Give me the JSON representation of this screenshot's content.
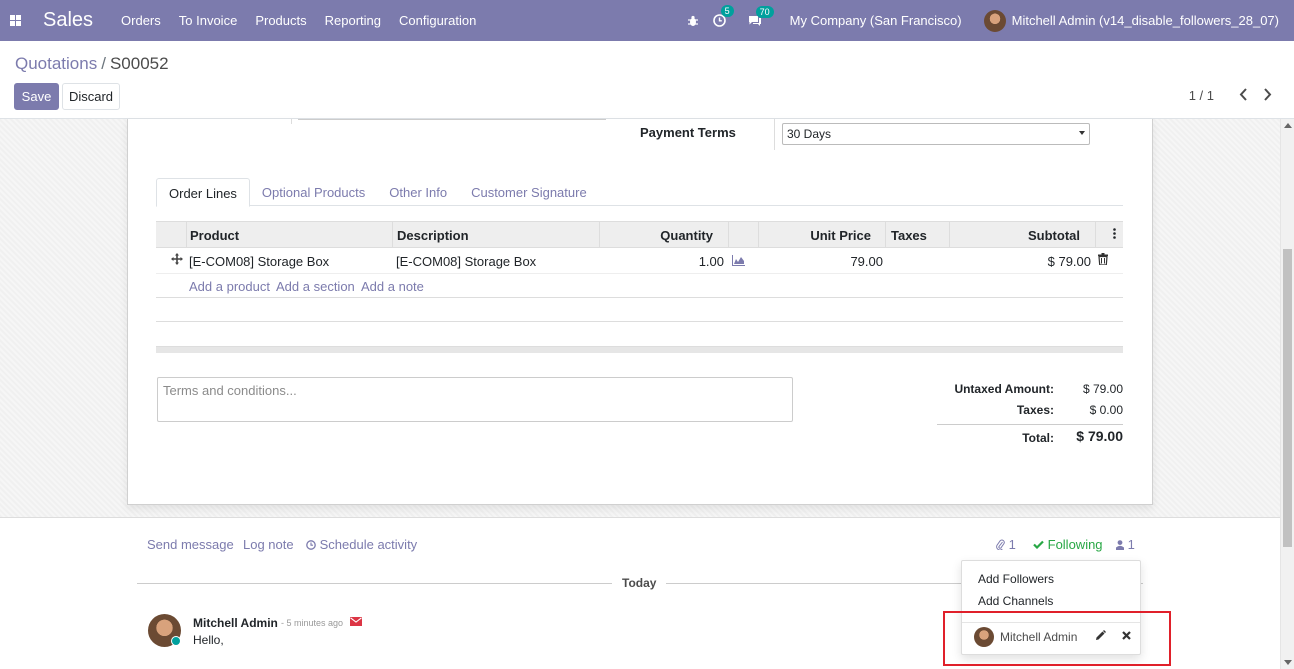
{
  "navbar": {
    "brand": "Sales",
    "menu": [
      "Orders",
      "To Invoice",
      "Products",
      "Reporting",
      "Configuration"
    ],
    "activity_badge": "5",
    "messages_badge": "70",
    "company": "My Company (San Francisco)",
    "user": "Mitchell Admin (v14_disable_followers_28_07)"
  },
  "control_panel": {
    "breadcrumb_parent": "Quotations",
    "breadcrumb_sep": "/",
    "breadcrumb_current": "S00052",
    "save_label": "Save",
    "discard_label": "Discard",
    "pager": "1 / 1"
  },
  "form": {
    "payment_terms_label": "Payment Terms",
    "payment_terms_value": "30 Days",
    "tabs": [
      "Order Lines",
      "Optional Products",
      "Other Info",
      "Customer Signature"
    ],
    "columns": [
      "Product",
      "Description",
      "Quantity",
      "Unit Price",
      "Taxes",
      "Subtotal"
    ],
    "lines": [
      {
        "product": "[E-COM08] Storage Box",
        "description": "[E-COM08] Storage Box",
        "quantity": "1.00",
        "unit_price": "79.00",
        "taxes": "",
        "subtotal": "$ 79.00"
      }
    ],
    "add_links": [
      "Add a product",
      "Add a section",
      "Add a note"
    ],
    "terms_placeholder": "Terms and conditions...",
    "totals": {
      "untaxed_label": "Untaxed Amount:",
      "untaxed_value": "$ 79.00",
      "taxes_label": "Taxes:",
      "taxes_value": "$ 0.00",
      "total_label": "Total:",
      "total_value": "$ 79.00"
    }
  },
  "chatter": {
    "send_message": "Send message",
    "log_note": "Log note",
    "schedule_activity": "Schedule activity",
    "attachments_count": "1",
    "following": "Following",
    "followers_count": "1",
    "today": "Today",
    "message": {
      "author": "Mitchell Admin",
      "time": "- 5 minutes ago",
      "body": "Hello,"
    }
  },
  "followers_dropdown": {
    "add_followers": "Add Followers",
    "add_channels": "Add Channels",
    "follower_name": "Mitchell Admin"
  },
  "colors": {
    "brand": "#7c7bad",
    "accent_teal": "#00a09d",
    "following_green": "#28a745",
    "highlight_red": "#e0202a"
  }
}
